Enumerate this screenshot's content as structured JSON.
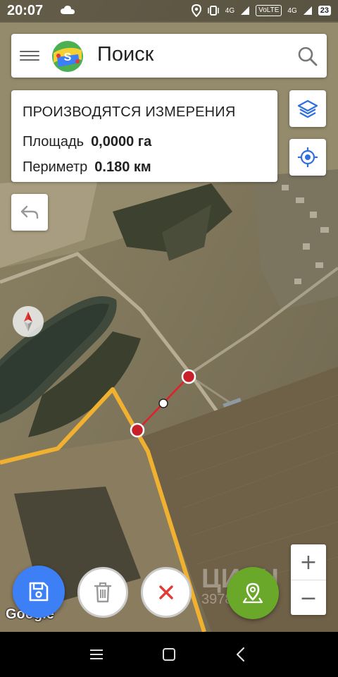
{
  "status_bar": {
    "time": "20:07",
    "network_left": "4G",
    "volte": "VoLTE",
    "network_right": "4G",
    "battery": "23"
  },
  "search_bar": {
    "title": "Поиск",
    "logo_letter": "S"
  },
  "measurement": {
    "heading": "ПРОИЗВОДЯТСЯ ИЗМЕРЕНИЯ",
    "area_label": "Площадь",
    "area_value": "0,0000 га",
    "perimeter_label": "Периметр",
    "perimeter_value": "0.180 км"
  },
  "map": {
    "attribution": "Google",
    "watermark_brand": "ЦИАН",
    "watermark_phone": "3978858 69",
    "route_color": "#f0b030",
    "measure_line_color": "#e0202a",
    "vertex_color": "#c8202a",
    "midpoint_color": "#ffffff"
  },
  "zoom": {
    "in_label": "+",
    "out_label": "−"
  },
  "icons": {
    "menu": "menu-icon",
    "search": "search-icon",
    "layers": "layers-icon",
    "locate": "crosshair-icon",
    "undo": "undo-icon",
    "compass": "compass-icon",
    "save": "save-icon",
    "delete": "trash-icon",
    "close": "close-icon",
    "pin": "map-pin-icon"
  },
  "colors": {
    "accent_blue": "#3d7ff5",
    "close_red": "#e53935",
    "pin_green": "#6aa829"
  }
}
